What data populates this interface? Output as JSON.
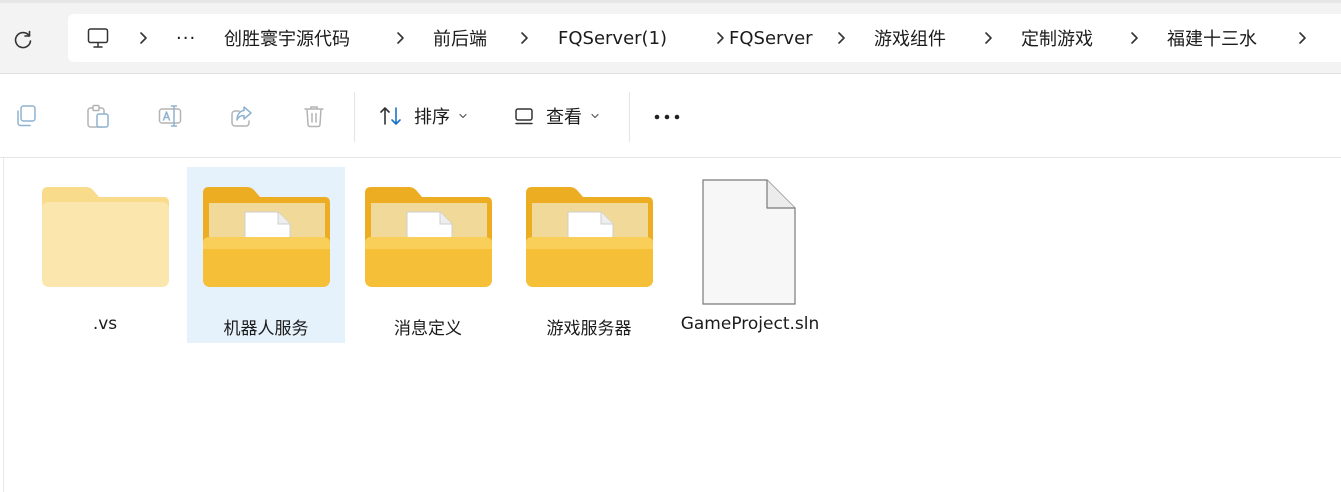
{
  "address_bar": {
    "more_crumbs": "···",
    "breadcrumbs": [
      "创胜寰宇源代码",
      "前后端",
      "FQServer(1)",
      "FQServer",
      "游戏组件",
      "定制游戏",
      "福建十三水"
    ]
  },
  "command_bar": {
    "sort_label": "排序",
    "view_label": "查看"
  },
  "files": [
    {
      "name": ".vs",
      "type": "folder-empty",
      "selected": false
    },
    {
      "name": "机器人服务",
      "type": "folder-with-file",
      "selected": true
    },
    {
      "name": "消息定义",
      "type": "folder-with-file",
      "selected": false
    },
    {
      "name": "游戏服务器",
      "type": "folder-with-file",
      "selected": false
    },
    {
      "name": "GameProject.sln",
      "type": "file",
      "selected": false
    }
  ],
  "colors": {
    "folder": "#f5c038",
    "folder_back": "#edad22",
    "selection": "#e5f1fb",
    "toolbar_disabled_icon": "#8fb3cf"
  }
}
